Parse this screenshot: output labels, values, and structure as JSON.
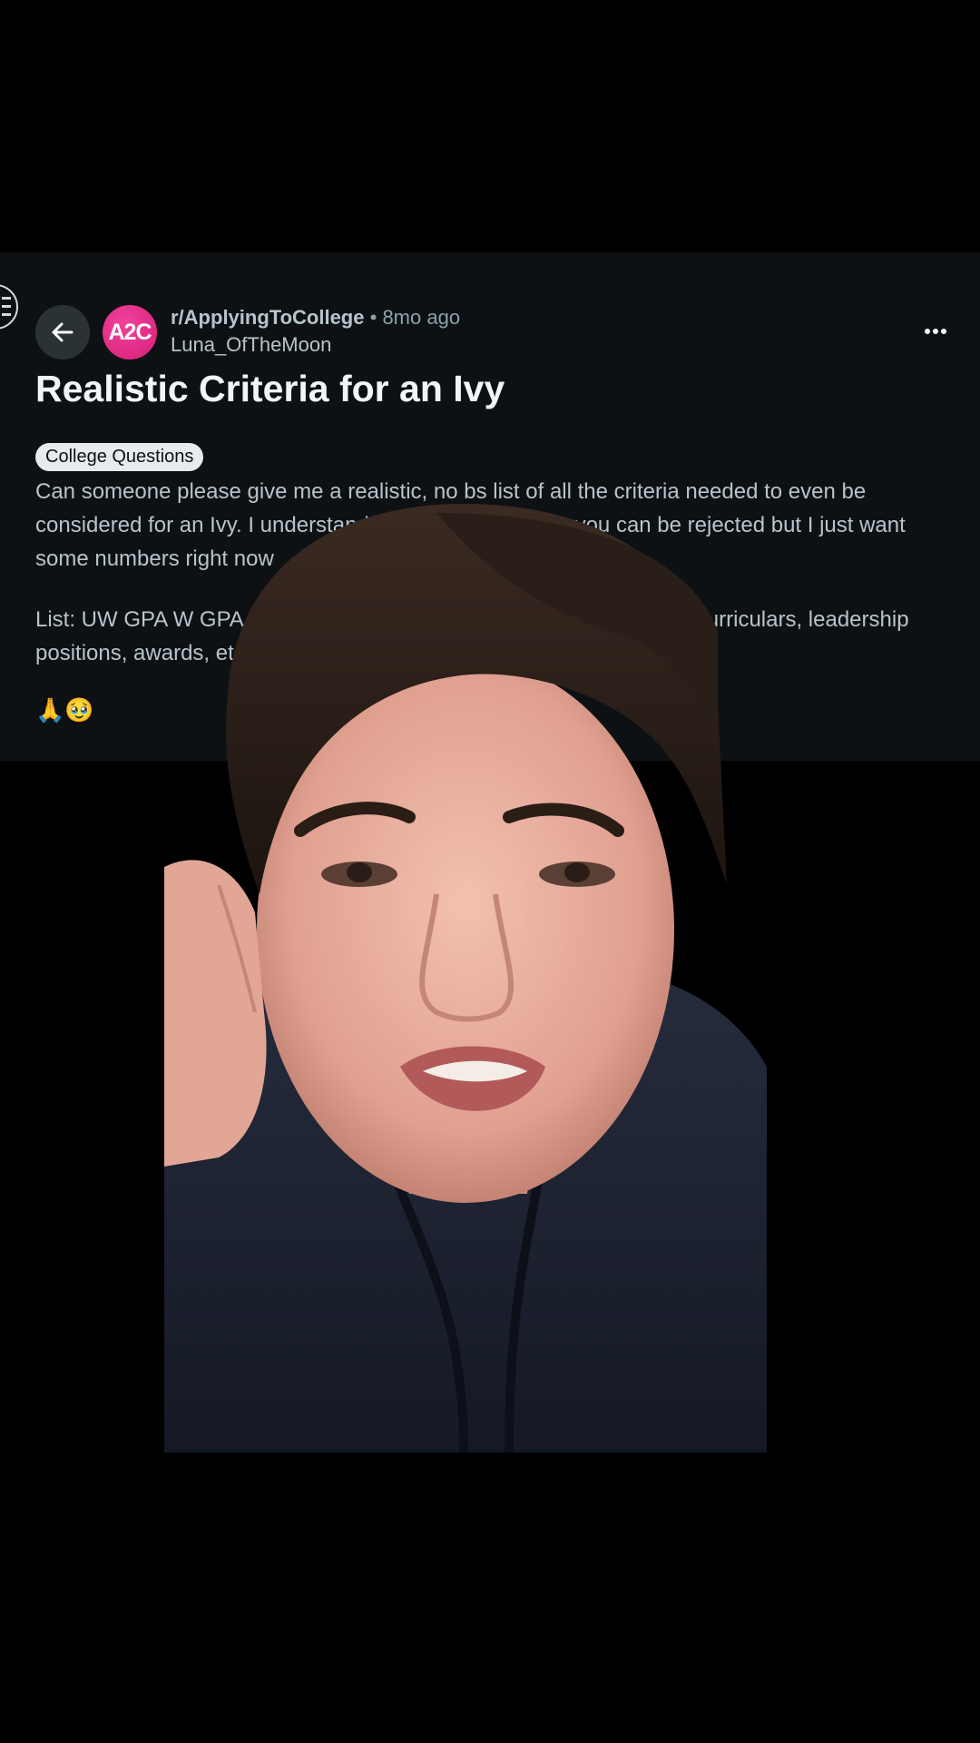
{
  "post": {
    "subreddit": "r/ApplyingToCollege",
    "separator": "•",
    "timestamp": "8mo ago",
    "author": "Luna_OfTheMoon",
    "avatar_text": "A2C",
    "title": "Realistic Criteria for an Ivy",
    "flair": "College Questions",
    "body_paragraphs": [
      "Can someone please give me a realistic, no bs list of all the criteria needed to even be considered for an Ivy. I understand that even with these you can be rejected but I just want some numbers right now",
      "List: UW GPA W GPA 5.0, SAT/ACT score, AP/Honors classes, extracurriculars, leadership positions, awards, etc."
    ],
    "emojis": "🙏🥹"
  },
  "colors": {
    "card_background": "#0e1113",
    "avatar_brand": "#e0338a",
    "text_primary": "#f2f4f5",
    "text_secondary": "#b7c4cc"
  },
  "icons": {
    "back": "arrow-left-icon",
    "more": "ellipsis-horizontal-icon",
    "edge": "menu-icon"
  }
}
